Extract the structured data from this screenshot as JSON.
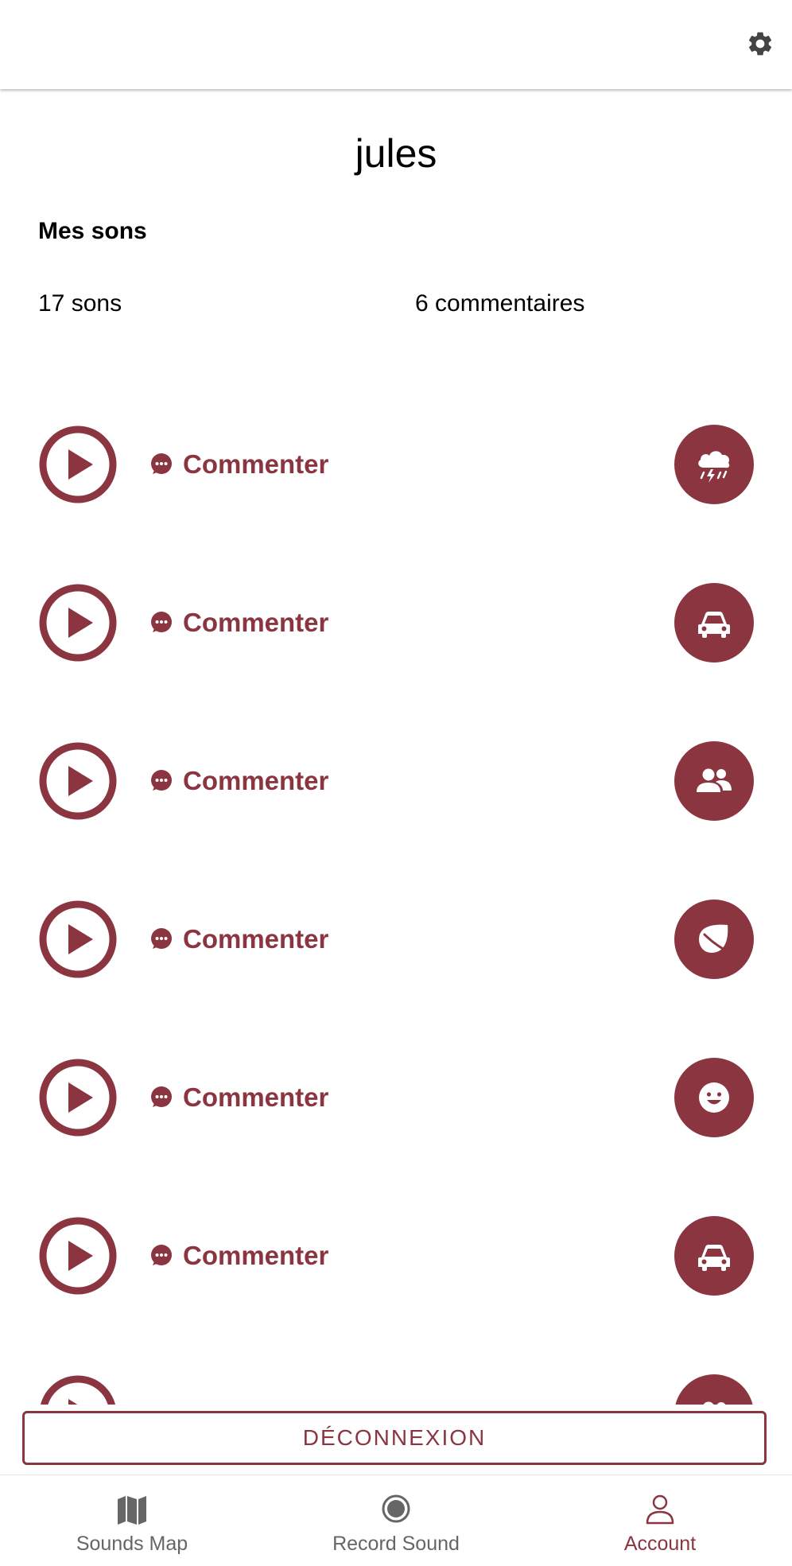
{
  "header": {
    "settings_icon": "gear-icon"
  },
  "profile": {
    "username": "jules",
    "section_title": "Mes sons",
    "sounds_count": "17 sons",
    "comments_count": "6 commentaires"
  },
  "sounds": [
    {
      "comment_label": "Commenter",
      "category_icon": "storm-icon"
    },
    {
      "comment_label": "Commenter",
      "category_icon": "car-icon"
    },
    {
      "comment_label": "Commenter",
      "category_icon": "people-icon"
    },
    {
      "comment_label": "Commenter",
      "category_icon": "leaf-icon"
    },
    {
      "comment_label": "Commenter",
      "category_icon": "smiley-icon"
    },
    {
      "comment_label": "Commenter",
      "category_icon": "car-icon"
    },
    {
      "comment_label": "",
      "category_icon": "people-icon"
    }
  ],
  "logout_label": "DÉCONNEXION",
  "nav": {
    "items": [
      {
        "label": "Sounds Map",
        "icon": "map-icon",
        "active": false
      },
      {
        "label": "Record Sound",
        "icon": "record-icon",
        "active": false
      },
      {
        "label": "Account",
        "icon": "account-icon",
        "active": true
      }
    ]
  },
  "colors": {
    "accent": "#8b3540",
    "inactive": "#666666"
  }
}
